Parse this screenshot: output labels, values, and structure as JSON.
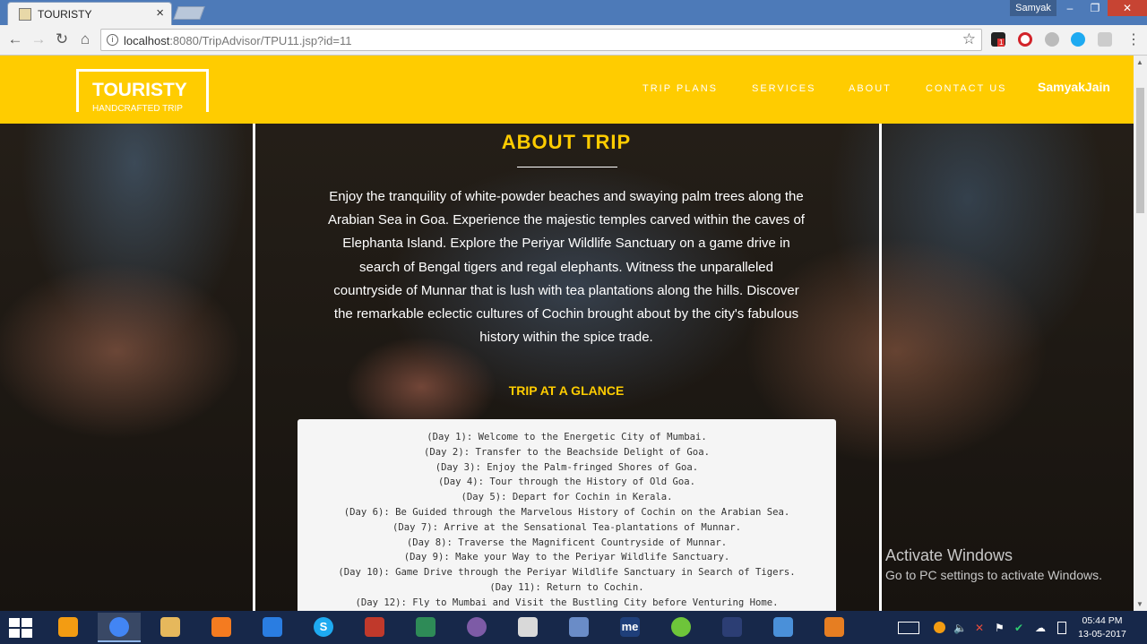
{
  "browser": {
    "tab_title": "TOURISTY",
    "tab_close": "×",
    "user_name": "Samyak",
    "window_minimize": "–",
    "window_restore": "❐",
    "window_close": "✕",
    "url_host": "localhost",
    "url_rest": ":8080/TripAdvisor/TPU11.jsp?id=11",
    "notification_count": "1"
  },
  "header": {
    "logo_title": "TOURISTY",
    "logo_subtitle": "HANDCRAFTED TRIP",
    "nav": [
      "TRIP PLANS",
      "SERVICES",
      "ABOUT",
      "CONTACT US"
    ],
    "user": "SamyakJain",
    "bg_color": "#ffcc00"
  },
  "about": {
    "title": "ABOUT TRIP",
    "lines": [
      "Enjoy the tranquility of white-powder beaches and swaying palm trees along the",
      "Arabian Sea in Goa. Experience the majestic temples carved within the caves of",
      "Elephanta Island. Explore the Periyar Wildlife Sanctuary on a game drive in",
      "search of Bengal tigers and regal elephants. Witness the unparalleled",
      "countryside of Munnar that is lush with tea plantations along the hills. Discover",
      "the remarkable eclectic cultures of Cochin brought about by the city's fabulous",
      "history within the spice trade."
    ]
  },
  "glance": {
    "title": "TRIP AT A GLANCE",
    "days": [
      "(Day 1): Welcome to the Energetic City of Mumbai.",
      "(Day 2): Transfer to the Beachside Delight of Goa.",
      "(Day 3): Enjoy the Palm-fringed Shores of Goa.",
      "(Day 4): Tour through the History of Old Goa.",
      "(Day 5): Depart for Cochin in Kerala.",
      "(Day 6): Be Guided through the Marvelous History of Cochin on the Arabian Sea.",
      "(Day 7): Arrive at the Sensational Tea-plantations of Munnar.",
      "(Day 8): Traverse the Magnificent Countryside of Munnar.",
      "(Day 9): Make your Way to the Periyar Wildlife Sanctuary.",
      "(Day 10): Game Drive through the Periyar Wildlife Sanctuary in Search of Tigers.",
      "(Day 11): Return to Cochin.",
      "(Day 12): Fly to Mumbai and Visit the Bustling City before Venturing Home."
    ]
  },
  "watermark": {
    "title": "Activate Windows",
    "subtitle": "Go to PC settings to activate Windows."
  },
  "taskbar": {
    "apps": [
      "explorer-icon",
      "chrome-icon",
      "file-manager-icon",
      "vlc-icon",
      "media-player-icon",
      "skype-icon",
      "screen-recorder-icon",
      "network-icon",
      "tor-icon",
      "notepad-icon",
      "eclipse-launcher-icon",
      "me-icon",
      "utorrent-icon",
      "eclipse-icon",
      "photo-viewer-icon",
      "java-icon"
    ],
    "app_labels": [
      "",
      "",
      "",
      "",
      "",
      "S",
      "",
      "",
      "",
      "",
      "",
      "me",
      "",
      "",
      "",
      ""
    ],
    "time": "05:44 PM",
    "date": "13-05-2017"
  }
}
